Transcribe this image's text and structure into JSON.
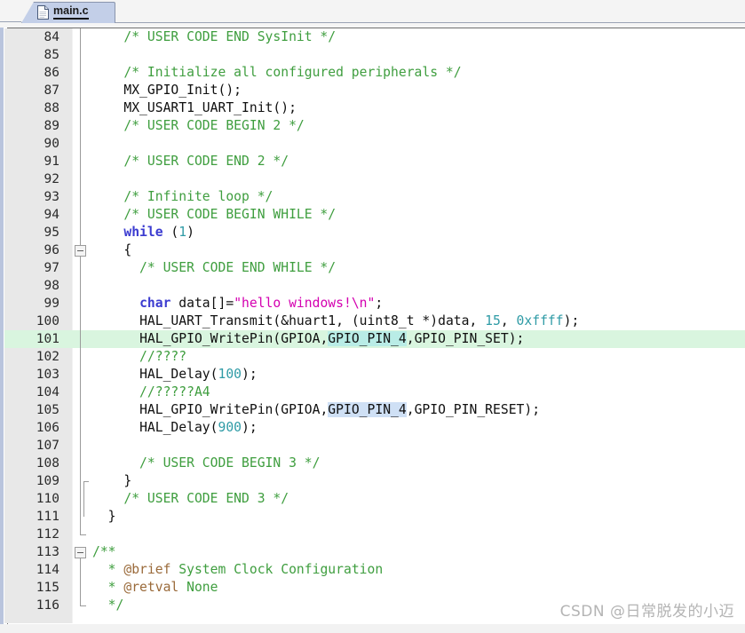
{
  "window": {
    "tab": {
      "label": "main.c",
      "icon": "file-icon",
      "active": true
    }
  },
  "watermark": {
    "text": "CSDN @日常脱发的小迈"
  },
  "editor": {
    "first_line": 84,
    "line_height": 20,
    "highlight_line": 101,
    "highlight_color": "#d9f5df",
    "selection_color_teal": "#b9ece6",
    "selection_color_blue": "#cfe0f5",
    "colors": {
      "comment": "#3f9e3f",
      "doc_tag": "#9a6a3a",
      "keyword": "#3b3bd0",
      "string": "#d400b0",
      "number": "#2f9ba6",
      "plain": "#101010",
      "gutter_bg": "#e8e8e8",
      "background": "#ffffff"
    },
    "lines": [
      {
        "n": 84,
        "text": "    /* USER CODE END SysInit */"
      },
      {
        "n": 85,
        "text": ""
      },
      {
        "n": 86,
        "text": "    /* Initialize all configured peripherals */"
      },
      {
        "n": 87,
        "text": "    MX_GPIO_Init();"
      },
      {
        "n": 88,
        "text": "    MX_USART1_UART_Init();"
      },
      {
        "n": 89,
        "text": "    /* USER CODE BEGIN 2 */"
      },
      {
        "n": 90,
        "text": ""
      },
      {
        "n": 91,
        "text": "    /* USER CODE END 2 */"
      },
      {
        "n": 92,
        "text": ""
      },
      {
        "n": 93,
        "text": "    /* Infinite loop */"
      },
      {
        "n": 94,
        "text": "    /* USER CODE BEGIN WHILE */"
      },
      {
        "n": 95,
        "text": "    while (1)"
      },
      {
        "n": 96,
        "text": "    {"
      },
      {
        "n": 97,
        "text": "      /* USER CODE END WHILE */"
      },
      {
        "n": 98,
        "text": ""
      },
      {
        "n": 99,
        "text": "      char data[]=\"hello windows!\\n\";"
      },
      {
        "n": 100,
        "text": "      HAL_UART_Transmit(&huart1, (uint8_t *)data, 15, 0xffff);"
      },
      {
        "n": 101,
        "text": "      HAL_GPIO_WritePin(GPIOA,GPIO_PIN_4,GPIO_PIN_SET);"
      },
      {
        "n": 102,
        "text": "      //????"
      },
      {
        "n": 103,
        "text": "      HAL_Delay(100);"
      },
      {
        "n": 104,
        "text": "      //?????A4"
      },
      {
        "n": 105,
        "text": "      HAL_GPIO_WritePin(GPIOA,GPIO_PIN_4,GPIO_PIN_RESET);"
      },
      {
        "n": 106,
        "text": "      HAL_Delay(900);"
      },
      {
        "n": 107,
        "text": ""
      },
      {
        "n": 108,
        "text": "      /* USER CODE BEGIN 3 */"
      },
      {
        "n": 109,
        "text": "    }"
      },
      {
        "n": 110,
        "text": "    /* USER CODE END 3 */"
      },
      {
        "n": 111,
        "text": "  }"
      },
      {
        "n": 112,
        "text": ""
      },
      {
        "n": 113,
        "text": "/**"
      },
      {
        "n": 114,
        "text": "  * @brief System Clock Configuration"
      },
      {
        "n": 115,
        "text": "  * @retval None"
      },
      {
        "n": 116,
        "text": "  */"
      }
    ],
    "fold_markers": [
      {
        "line": 96,
        "type": "collapse-box"
      },
      {
        "line": 113,
        "type": "collapse-box"
      }
    ]
  }
}
